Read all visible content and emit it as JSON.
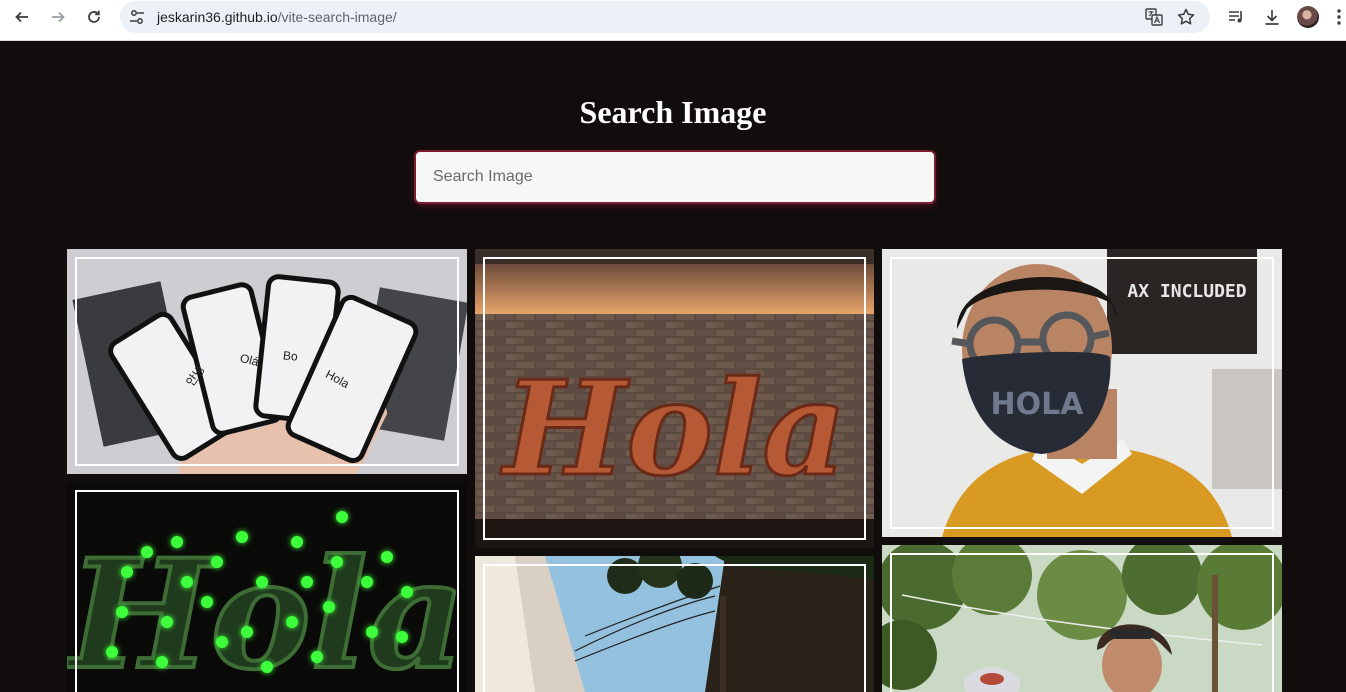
{
  "browser": {
    "url_host": "jeskarin36.github.io",
    "url_path": "/vite-search-image/"
  },
  "page": {
    "title": "Search Image",
    "search_placeholder": "Search Image"
  },
  "images": [
    {
      "subject": "four smartphones",
      "texts": [
        "안녕",
        "Olá",
        "Bo",
        "Hola"
      ]
    },
    {
      "subject": "marquee bulb sign on brick wall",
      "texts": [
        "Hola"
      ]
    },
    {
      "subject": "man with glasses and face mask",
      "texts": [
        "AX  INCLUDED",
        "HOLA"
      ]
    },
    {
      "subject": "green neon sign",
      "texts": [
        "Hola"
      ]
    },
    {
      "subject": "street with power lines",
      "texts": []
    },
    {
      "subject": "people outdoors under trees",
      "texts": []
    }
  ],
  "colors": {
    "page_background": "#120d0d",
    "search_glow": "#7b1c33",
    "title": "#ffffff"
  }
}
